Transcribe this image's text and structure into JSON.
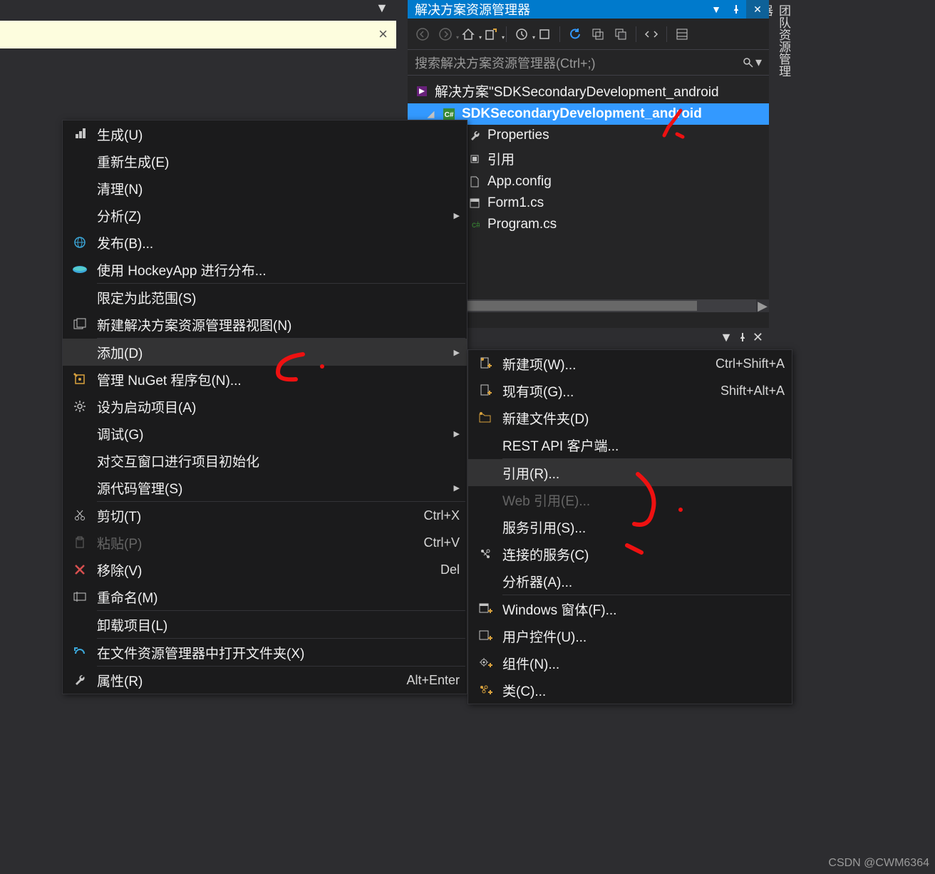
{
  "top_dropdown": "▼",
  "yellow_bar": {
    "close": "×"
  },
  "solution_explorer": {
    "title": "解决方案资源管理器",
    "search_placeholder": "搜索解决方案资源管理器(Ctrl+;)",
    "tree": {
      "solution_label": "解决方案\"SDKSecondaryDevelopment_android",
      "project": "SDKSecondaryDevelopment_android",
      "items": [
        "Properties",
        "引用",
        "App.config",
        "Form1.cs",
        "Program.cs"
      ]
    }
  },
  "right_tab_label": "团队资源管理器",
  "context_menu": {
    "items": [
      {
        "icon": "build",
        "label": "生成(U)"
      },
      {
        "icon": "",
        "label": "重新生成(E)"
      },
      {
        "icon": "",
        "label": "清理(N)"
      },
      {
        "icon": "",
        "label": "分析(Z)",
        "arrow": true
      },
      {
        "icon": "globe",
        "label": "发布(B)..."
      },
      {
        "icon": "hockey",
        "label": "使用 HockeyApp 进行分布..."
      },
      {
        "sep": true
      },
      {
        "icon": "",
        "label": "限定为此范围(S)"
      },
      {
        "icon": "newview",
        "label": "新建解决方案资源管理器视图(N)"
      },
      {
        "sep": true
      },
      {
        "icon": "",
        "label": "添加(D)",
        "arrow": true,
        "highlight": true
      },
      {
        "icon": "nuget",
        "label": "管理 NuGet 程序包(N)..."
      },
      {
        "icon": "gear",
        "label": "设为启动项目(A)"
      },
      {
        "icon": "",
        "label": "调试(G)",
        "arrow": true
      },
      {
        "icon": "",
        "label": "对交互窗口进行项目初始化"
      },
      {
        "icon": "",
        "label": "源代码管理(S)",
        "arrow": true
      },
      {
        "sep": true
      },
      {
        "icon": "cut",
        "label": "剪切(T)",
        "shortcut": "Ctrl+X"
      },
      {
        "icon": "paste",
        "label": "粘贴(P)",
        "shortcut": "Ctrl+V",
        "disabled": true
      },
      {
        "icon": "remove",
        "label": "移除(V)",
        "shortcut": "Del"
      },
      {
        "icon": "rename",
        "label": "重命名(M)"
      },
      {
        "sep": true
      },
      {
        "icon": "",
        "label": "卸载项目(L)"
      },
      {
        "sep": true
      },
      {
        "icon": "openfolder",
        "label": "在文件资源管理器中打开文件夹(X)"
      },
      {
        "sep": true
      },
      {
        "icon": "wrench",
        "label": "属性(R)",
        "shortcut": "Alt+Enter"
      }
    ]
  },
  "submenu": {
    "items": [
      {
        "icon": "newitem",
        "label": "新建项(W)...",
        "shortcut": "Ctrl+Shift+A"
      },
      {
        "icon": "existitem",
        "label": "现有项(G)...",
        "shortcut": "Shift+Alt+A"
      },
      {
        "icon": "newfolder",
        "label": "新建文件夹(D)"
      },
      {
        "icon": "",
        "label": "REST API 客户端..."
      },
      {
        "sep": true
      },
      {
        "icon": "",
        "label": "引用(R)...",
        "highlight": true
      },
      {
        "icon": "",
        "label": "Web 引用(E)...",
        "disabled": true
      },
      {
        "icon": "",
        "label": "服务引用(S)..."
      },
      {
        "icon": "connected",
        "label": "连接的服务(C)"
      },
      {
        "icon": "",
        "label": "分析器(A)..."
      },
      {
        "sep": true
      },
      {
        "icon": "addform",
        "label": "Windows 窗体(F)..."
      },
      {
        "icon": "adduc",
        "label": "用户控件(U)..."
      },
      {
        "icon": "addcomp",
        "label": "组件(N)..."
      },
      {
        "icon": "addclass",
        "label": "类(C)..."
      }
    ]
  },
  "watermark": "CSDN @CWM6364"
}
